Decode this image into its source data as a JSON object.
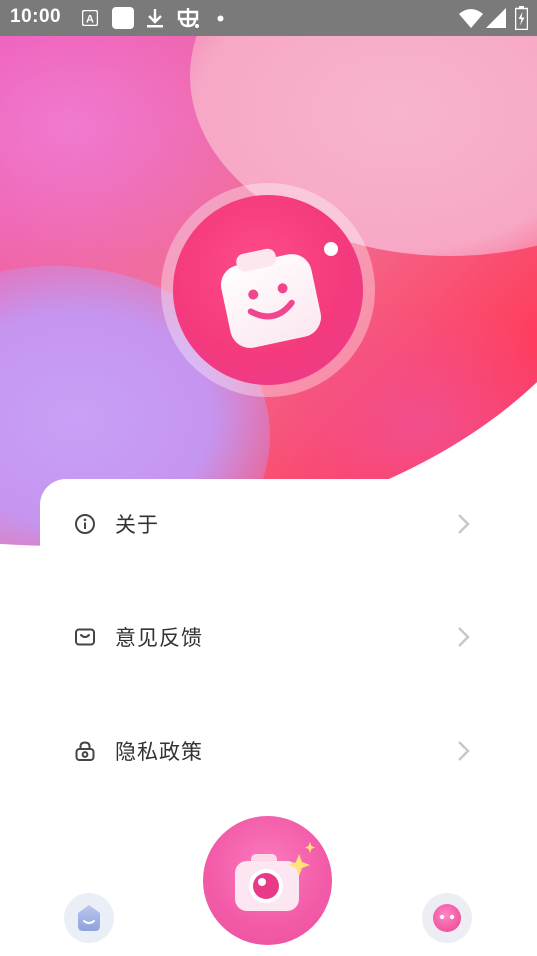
{
  "status_bar": {
    "time": "10:00",
    "left_icons": [
      "a-icon",
      "square-icon",
      "download-icon",
      "bug-icon",
      "dot-icon"
    ],
    "right_icons": [
      "wifi-icon",
      "signal-icon",
      "battery-icon"
    ]
  },
  "colors": {
    "status_bar": "#7a7a7a",
    "accent": "#f25aa7",
    "menu_text": "#333333",
    "chevron": "#c8c8c8"
  },
  "menu": {
    "items": [
      {
        "label": "关于",
        "icon": "info-icon"
      },
      {
        "label": "意见反馈",
        "icon": "feedback-icon"
      },
      {
        "label": "隐私政策",
        "icon": "lock-icon"
      }
    ]
  },
  "bottom_nav": {
    "left_icon": "home-icon",
    "center_icon": "camera-icon",
    "right_icon": "profile-icon"
  }
}
